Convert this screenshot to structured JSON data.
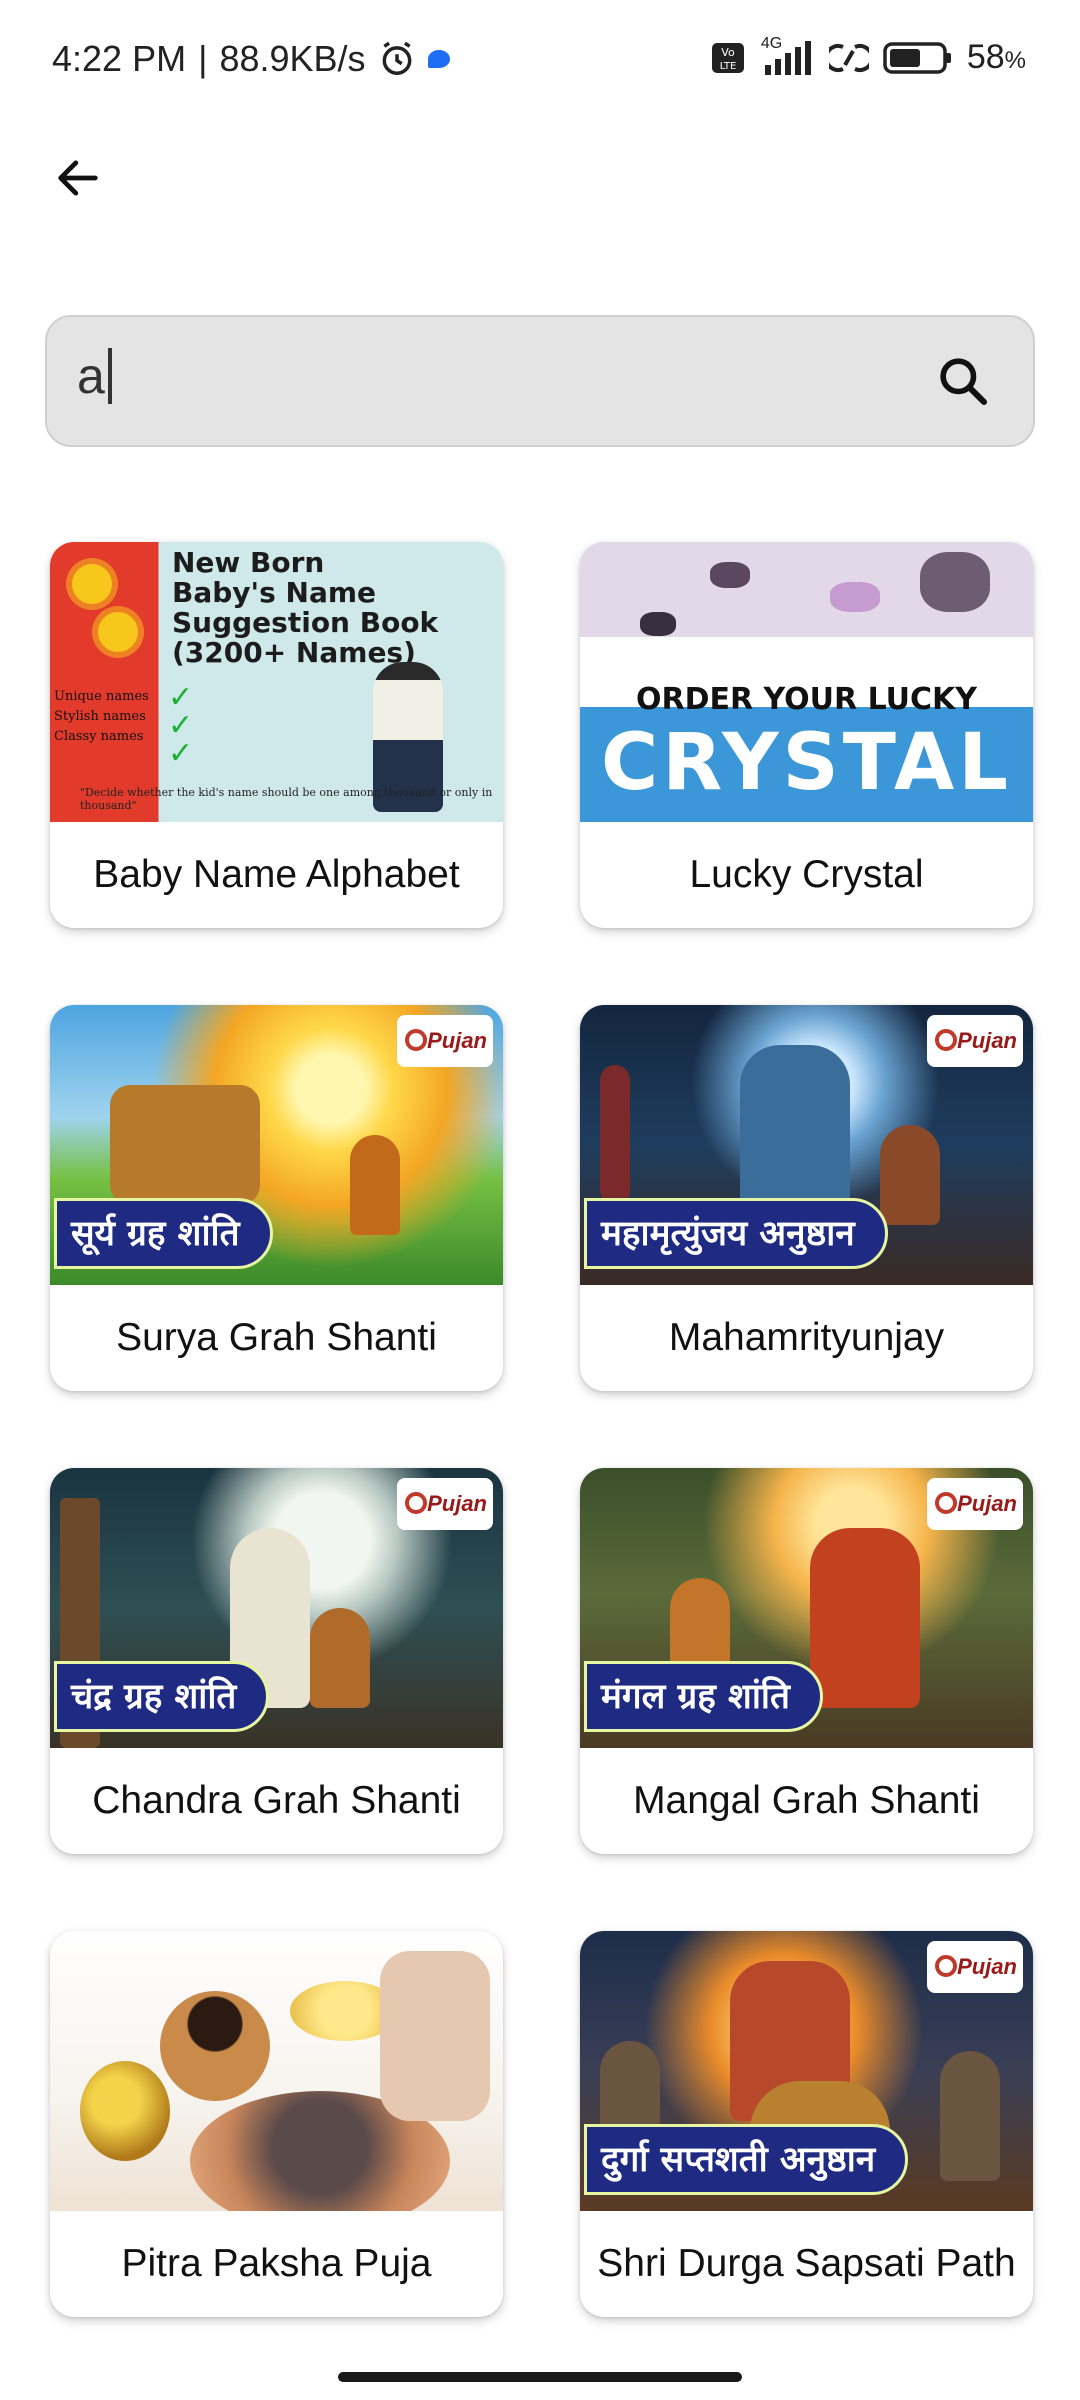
{
  "status_bar": {
    "time": "4:22 PM",
    "separator": "|",
    "net_speed": "88.9KB/s",
    "network": "4G",
    "battery": "58",
    "battery_unit": "%",
    "icons": [
      "alarm-icon",
      "chat-bubble-icon",
      "volte-icon",
      "signal-icon",
      "hotspot-icon",
      "battery-icon"
    ]
  },
  "header": {
    "back_icon": "arrow-left-icon"
  },
  "search": {
    "value": "a",
    "icon": "search-icon"
  },
  "cards": [
    {
      "title": "Baby Name Alphabet",
      "image": {
        "headline": [
          "New Born",
          "Baby's Name",
          "Suggestion Book",
          "(3200+ Names)"
        ],
        "features": [
          "Unique names",
          "Stylish names",
          "Classy names"
        ],
        "quote": "\"Decide whether the kid's name should be one among thousand or only in thousand\""
      }
    },
    {
      "title": "Lucky Crystal",
      "image": {
        "line1": "ORDER YOUR LUCKY",
        "line2": "CRYSTAL"
      }
    },
    {
      "title": "Surya Grah Shanti",
      "image": {
        "badge": "सूर्य ग्रह शांति",
        "logo": "Pujan"
      }
    },
    {
      "title": "Mahamrityunjay",
      "image": {
        "badge": "महामृत्युंजय अनुष्ठान",
        "logo": "Pujan"
      }
    },
    {
      "title": "Chandra Grah Shanti",
      "image": {
        "badge": "चंद्र ग्रह शांति",
        "logo": "Pujan"
      }
    },
    {
      "title": "Mangal Grah Shanti",
      "image": {
        "badge": "मंगल ग्रह शांति",
        "logo": "Pujan"
      }
    },
    {
      "title": "Pitra Paksha Puja",
      "image": {}
    },
    {
      "title": "Shri Durga Sapsati Path",
      "image": {
        "badge": "दुर्गा सप्तशती अनुष्ठान",
        "logo": "Pujan"
      }
    }
  ]
}
